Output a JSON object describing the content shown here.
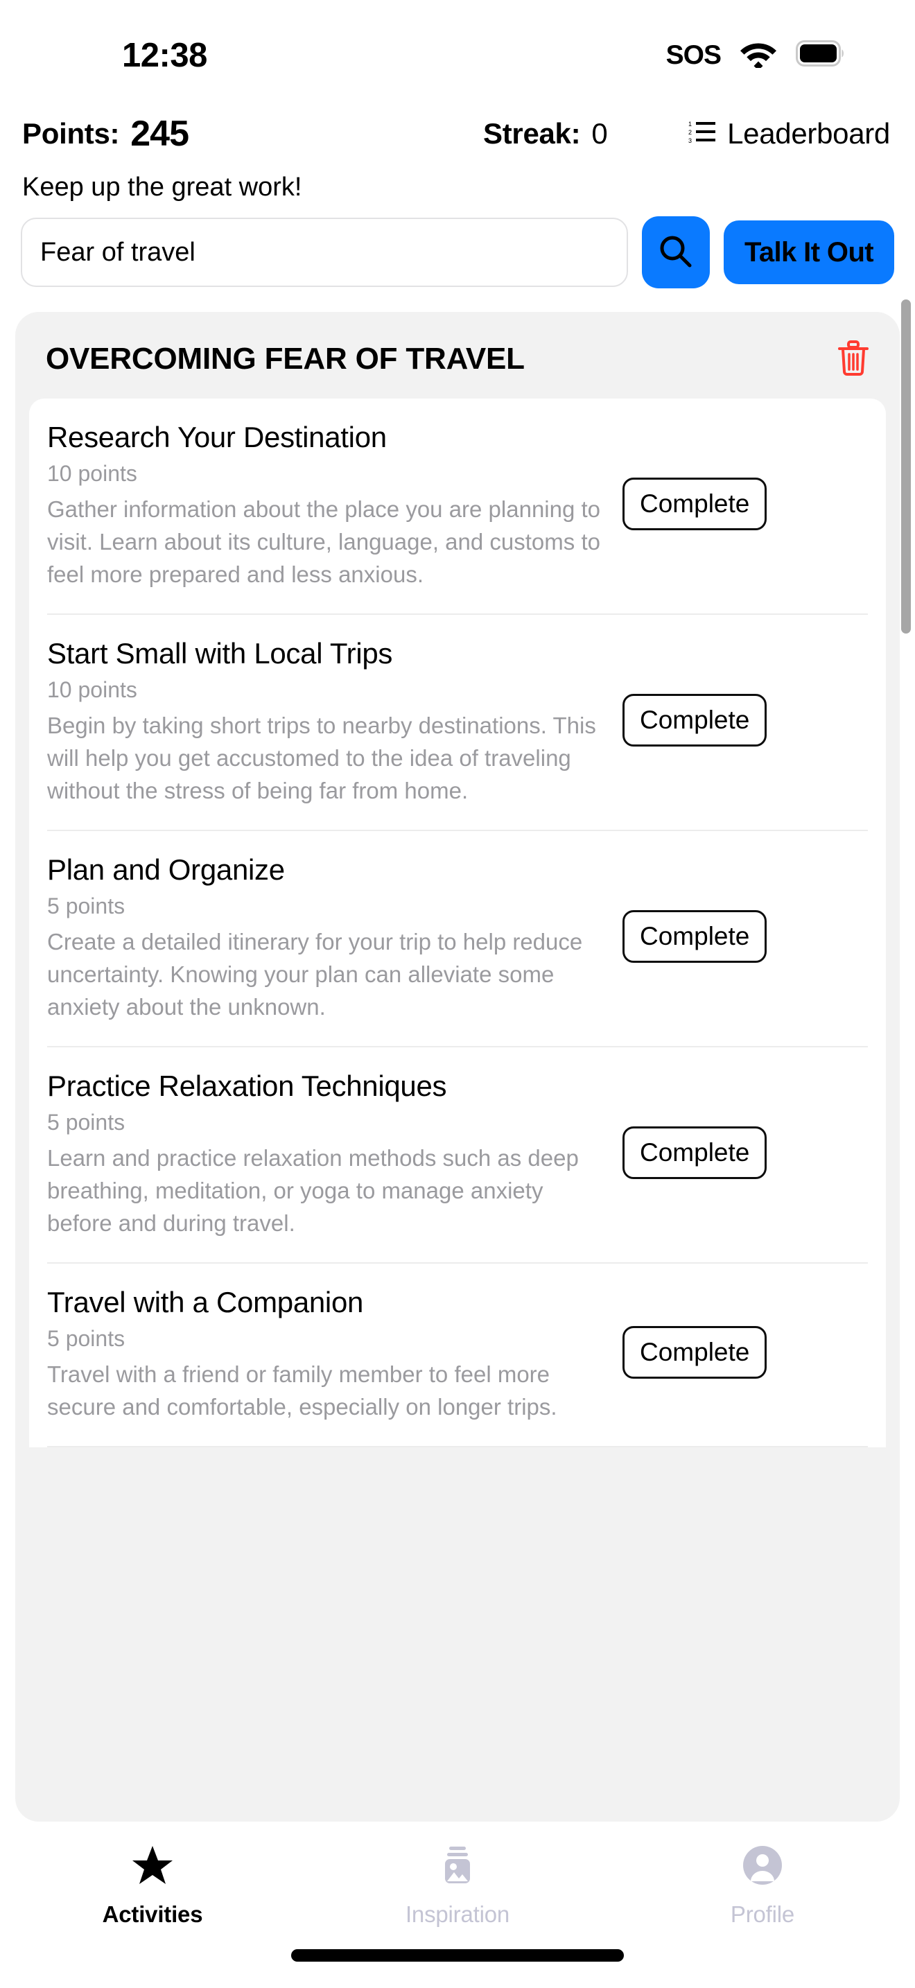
{
  "status_bar": {
    "time": "12:38",
    "sos": "SOS",
    "wifi_icon": "wifi-icon",
    "battery_icon": "battery-full-icon"
  },
  "header": {
    "points_label": "Points:",
    "points_value": "245",
    "streak_label": "Streak:",
    "streak_value": "0",
    "leaderboard_label": "Leaderboard",
    "leaderboard_icon": "ordered-list-icon",
    "subtitle": "Keep up the great work!"
  },
  "search": {
    "value": "Fear of travel",
    "placeholder": "Fear of travel",
    "search_icon": "search-icon",
    "talk_it_out_label": "Talk It Out",
    "accent_color": "#0a7aff"
  },
  "group": {
    "title": "OVERCOMING FEAR OF TRAVEL",
    "delete_icon": "trash-icon",
    "delete_color": "#ff3b30",
    "tasks": [
      {
        "title": "Research Your Destination",
        "points": "10 points",
        "description": "Gather information about the place you are planning to visit. Learn about its culture, language, and customs to feel more prepared and less anxious.",
        "action": "Complete"
      },
      {
        "title": "Start Small with Local Trips",
        "points": "10 points",
        "description": "Begin by taking short trips to nearby destinations. This will help you get accustomed to the idea of traveling without the stress of being far from home.",
        "action": "Complete"
      },
      {
        "title": "Plan and Organize",
        "points": "5 points",
        "description": "Create a detailed itinerary for your trip to help reduce uncertainty. Knowing your plan can alleviate some anxiety about the unknown.",
        "action": "Complete"
      },
      {
        "title": "Practice Relaxation Techniques",
        "points": "5 points",
        "description": "Learn and practice relaxation methods such as deep breathing, meditation, or yoga to manage anxiety before and during travel.",
        "action": "Complete"
      },
      {
        "title": "Travel with a Companion",
        "points": "5 points",
        "description": "Travel with a friend or family member to feel more secure and comfortable, especially on longer trips.",
        "action": "Complete"
      }
    ]
  },
  "tab_bar": {
    "tabs": [
      {
        "label": "Activities",
        "icon": "star-icon",
        "active": true
      },
      {
        "label": "Inspiration",
        "icon": "photo-stack-icon",
        "active": false
      },
      {
        "label": "Profile",
        "icon": "person-circle-icon",
        "active": false
      }
    ]
  }
}
